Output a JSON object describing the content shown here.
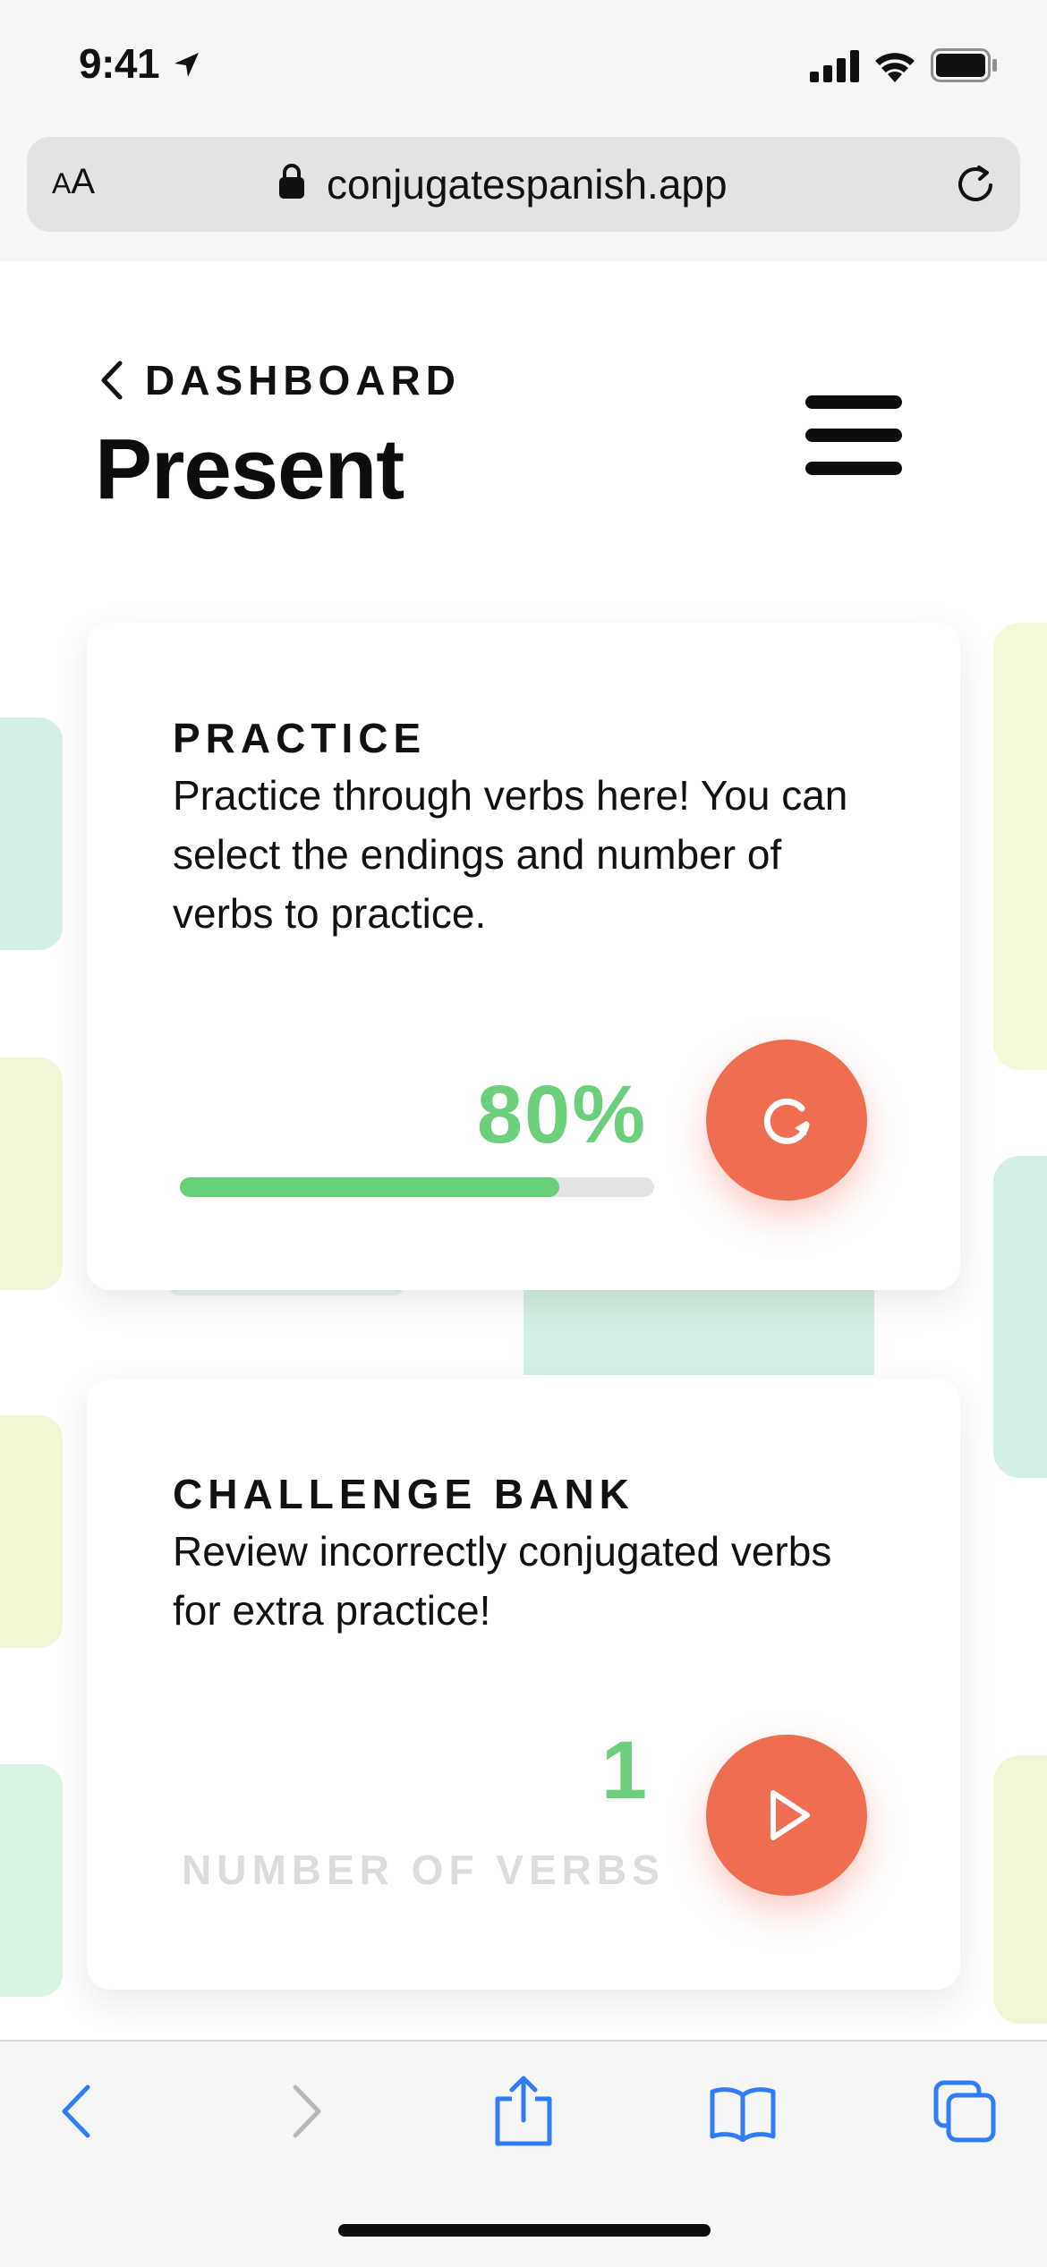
{
  "status_bar": {
    "time": "9:41"
  },
  "address_bar": {
    "text_size_small": "A",
    "text_size_large": "A",
    "url": "conjugatespanish.app"
  },
  "header": {
    "back_label": "DASHBOARD",
    "title": "Present"
  },
  "practice_card": {
    "heading": "PRACTICE",
    "description": "Practice through verbs here! You can select the endings and number of verbs to practice.",
    "progress_label": "80%",
    "progress_value": 0.8
  },
  "challenge_card": {
    "heading": "CHALLENGE BANK",
    "description": "Review incorrectly conjugated verbs for extra practice!",
    "verb_count": "1",
    "verb_count_label": "NUMBER OF VERBS"
  },
  "colors": {
    "accent": "#ef6e52",
    "success": "#6ccf7c",
    "safari_blue": "#2f7cf6"
  },
  "icons": {
    "status_bar": [
      "location-arrow-icon",
      "signal-icon",
      "wifi-icon",
      "battery-icon"
    ],
    "address_bar": [
      "lock-icon",
      "reload-icon"
    ],
    "toolbar": [
      "back-chevron-icon",
      "forward-chevron-icon",
      "share-icon",
      "bookmarks-icon",
      "tabs-icon"
    ]
  }
}
